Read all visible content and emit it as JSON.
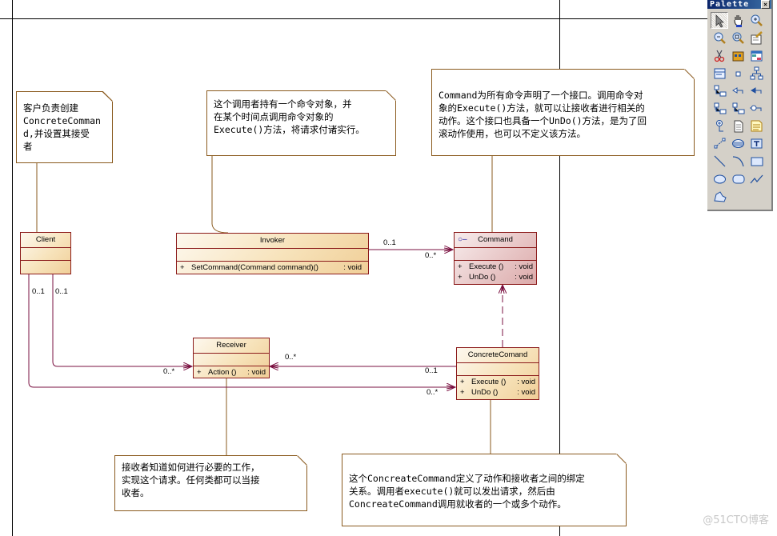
{
  "palette": {
    "title": "Palette",
    "close_label": "×",
    "tools": [
      {
        "name": "pointer-icon",
        "selected": true
      },
      {
        "name": "hand-pan-icon"
      },
      {
        "name": "zoom-in-icon"
      },
      {
        "name": "zoom-out-icon"
      },
      {
        "name": "zoom-fit-icon"
      },
      {
        "name": "properties-icon"
      },
      {
        "name": "cut-icon"
      },
      {
        "name": "package-icon"
      },
      {
        "name": "table-icon"
      },
      {
        "name": "class-icon"
      },
      {
        "name": "small-square-icon"
      },
      {
        "name": "hierarchy-icon"
      },
      {
        "name": "realization-icon"
      },
      {
        "name": "dependency-icon"
      },
      {
        "name": "association-icon"
      },
      {
        "name": "generalization-icon"
      },
      {
        "name": "inner-link-icon"
      },
      {
        "name": "interface-link-icon"
      },
      {
        "name": "port-icon"
      },
      {
        "name": "file-icon"
      },
      {
        "name": "note-icon"
      },
      {
        "name": "link-icon"
      },
      {
        "name": "separator-icon"
      },
      {
        "name": "text-icon"
      },
      {
        "name": "line-icon"
      },
      {
        "name": "arc-icon"
      },
      {
        "name": "rectangle-icon"
      },
      {
        "name": "ellipse-icon"
      },
      {
        "name": "rounded-rectangle-icon"
      },
      {
        "name": "polyline-icon"
      },
      {
        "name": "polygon-icon"
      }
    ]
  },
  "colors": {
    "class_border": "#8b1a1a",
    "connector": "#7a1040",
    "note_border": "#8a5a1e",
    "class_fill": "#f7e3bb",
    "interface_fill": "#e8c7c7"
  },
  "classes": {
    "client": {
      "name": "Client",
      "operations": []
    },
    "invoker": {
      "name": "Invoker",
      "operations": [
        {
          "vis": "+",
          "sig": "SetCommand(Command command)()",
          "ret": ": void"
        }
      ]
    },
    "command": {
      "name": "Command",
      "stereotype_icon": "interface-icon",
      "operations": [
        {
          "vis": "+",
          "sig": "Execute ()",
          "ret": ": void"
        },
        {
          "vis": "+",
          "sig": "UnDo ()",
          "ret": ": void"
        }
      ]
    },
    "receiver": {
      "name": "Receiver",
      "operations": [
        {
          "vis": "+",
          "sig": "Action ()",
          "ret": ": void"
        }
      ]
    },
    "concrete": {
      "name": "ConcreteComand",
      "operations": [
        {
          "vis": "+",
          "sig": "Execute ()",
          "ret": ": void"
        },
        {
          "vis": "+",
          "sig": "UnDo ()",
          "ret": ": void"
        }
      ]
    }
  },
  "multiplicities": {
    "invoker_command_src": "0..1",
    "invoker_command_dst": "0..*",
    "client_receiver_src": "0..1",
    "client_concrete_src": "0..1",
    "client_receiver_dst": "0..*",
    "client_concrete_dst": "0..*",
    "concrete_receiver_src": "0..1",
    "concrete_receiver_dst": "0..*"
  },
  "notes": {
    "client": "客户负责创建\nConcreteComman\nd,并设置其接受\n者",
    "invoker": "这个调用者持有一个命令对象，并\n在某个时间点调用命令对象的\nExecute()方法，将请求付诸实行。",
    "command": "Command为所有命令声明了一个接口。调用命令对\n象的Execute()方法，就可以让接收者进行相关的\n动作。这个接口也具备一个UnDo()方法，是为了回\n滚动作使用，也可以不定义该方法。",
    "receiver": "接收者知道如何进行必要的工作，\n实现这个请求。任何类都可以当接\n收者。",
    "concrete": "这个ConcreateCommand定义了动作和接收者之间的绑定\n关系。调用者execute()就可以发出请求，然后由\nConcreateCommand调用就收者的一个或多个动作。"
  },
  "watermark": "@51CTO博客"
}
